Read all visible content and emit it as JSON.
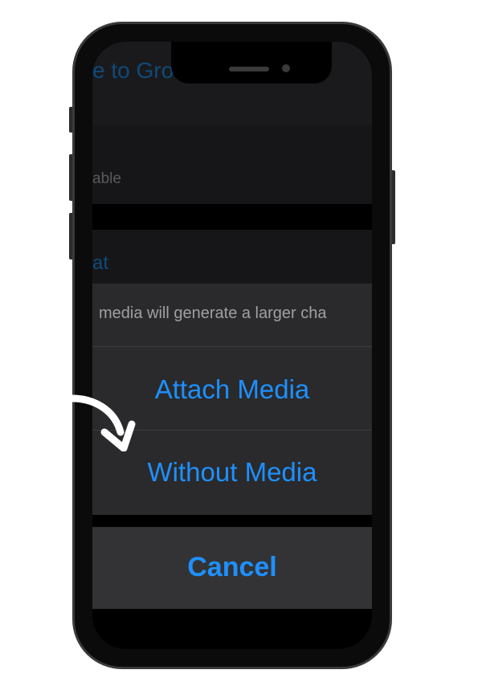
{
  "background_rows": {
    "invite_link_fragment": "e to Group via Link",
    "available_fragment": "able",
    "section_fragment": "at"
  },
  "action_sheet": {
    "message": "media will generate a larger cha",
    "attach_media": "Attach Media",
    "without_media": "Without Media",
    "cancel": "Cancel"
  },
  "colors": {
    "accent": "#1e90ff",
    "sheet": "#2a2a2c",
    "cancel_sheet": "#333335"
  },
  "icons": [
    "curved-arrow-icon"
  ]
}
